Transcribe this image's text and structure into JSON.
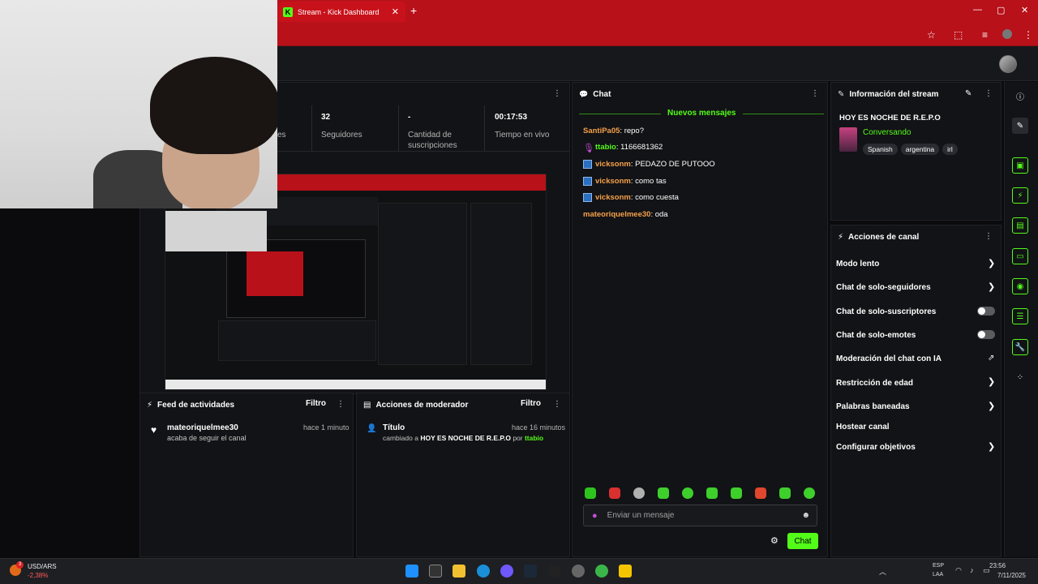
{
  "browser": {
    "tab_title": "Stream - Kick Dashboard",
    "tab_close": "✕",
    "new_tab": "+",
    "window_controls": [
      "—",
      "▢",
      "✕"
    ]
  },
  "stats": {
    "followers_value": "32",
    "followers_label": "Seguidores",
    "subs_value": "-",
    "subs_label": "Cantidad de suscripciones",
    "uptime_value": "00:17:53",
    "uptime_label": "Tiempo en vivo",
    "partial_label": "es"
  },
  "chat": {
    "title": "Chat",
    "new_messages": "Nuevos mensajes",
    "messages": [
      {
        "user": "SantiPa05",
        "text": ": repo?",
        "color": "orange",
        "badge": "none"
      },
      {
        "user": "ttabio",
        "text": ": 1166681362",
        "color": "green",
        "badge": "mic"
      },
      {
        "user": "vicksonm",
        "text": ": PEDAZO DE PUTOOO",
        "color": "orange",
        "badge": "mod"
      },
      {
        "user": "vicksonm",
        "text": ": como tas",
        "color": "orange",
        "badge": "mod"
      },
      {
        "user": "vicksonm",
        "text": ": como cuesta",
        "color": "orange",
        "badge": "mod"
      },
      {
        "user": "mateoriquelmee30",
        "text": ": oda",
        "color": "orange",
        "badge": "none"
      }
    ],
    "input_placeholder": "Enviar un mensaje",
    "send_label": "Chat"
  },
  "stream_info": {
    "title": "Información del stream",
    "stream_title": "HOY ES NOCHE DE R.E.P.O",
    "category": "Conversando",
    "tags": [
      "Spanish",
      "argentina",
      "irl"
    ]
  },
  "channel_actions": {
    "title": "Acciones de canal",
    "items": [
      {
        "label": "Modo lento",
        "control": "chevron"
      },
      {
        "label": "Chat de solo-seguidores",
        "control": "chevron"
      },
      {
        "label": "Chat de solo-suscriptores",
        "control": "toggle"
      },
      {
        "label": "Chat de solo-emotes",
        "control": "toggle"
      },
      {
        "label": "Moderación del chat con IA",
        "control": "external"
      },
      {
        "label": "Restricción de edad",
        "control": "chevron"
      },
      {
        "label": "Palabras baneadas",
        "control": "chevron"
      },
      {
        "label": "Hostear canal",
        "control": "none"
      },
      {
        "label": "Configurar objetivos",
        "control": "chevron"
      }
    ]
  },
  "activity_feed": {
    "title": "Feed de actividades",
    "filter": "Filtro",
    "entry_user": "mateoriquelmee30",
    "entry_time": "hace 1 minuto",
    "entry_text": "acaba de seguir el canal"
  },
  "mod_actions": {
    "title": "Acciones de moderador",
    "filter": "Filtro",
    "entry_title": "Título",
    "entry_time": "hace 16 minutos",
    "entry_prefix": "cambiado a ",
    "entry_value": "HOY ES NOCHE DE R.E.P.O",
    "entry_by": " por ",
    "entry_user": "ttabio"
  },
  "taskbar": {
    "ticker_name": "USD/ARS",
    "ticker_change": "-2,38%",
    "ticker_badge": "3",
    "lang_top": "ESP",
    "lang_bottom": "LAA",
    "time": "23:56",
    "date": "7/11/2025"
  },
  "colors": {
    "accent": "#53fc18",
    "browser_red": "#b8111a",
    "username": "#f5a04a"
  }
}
